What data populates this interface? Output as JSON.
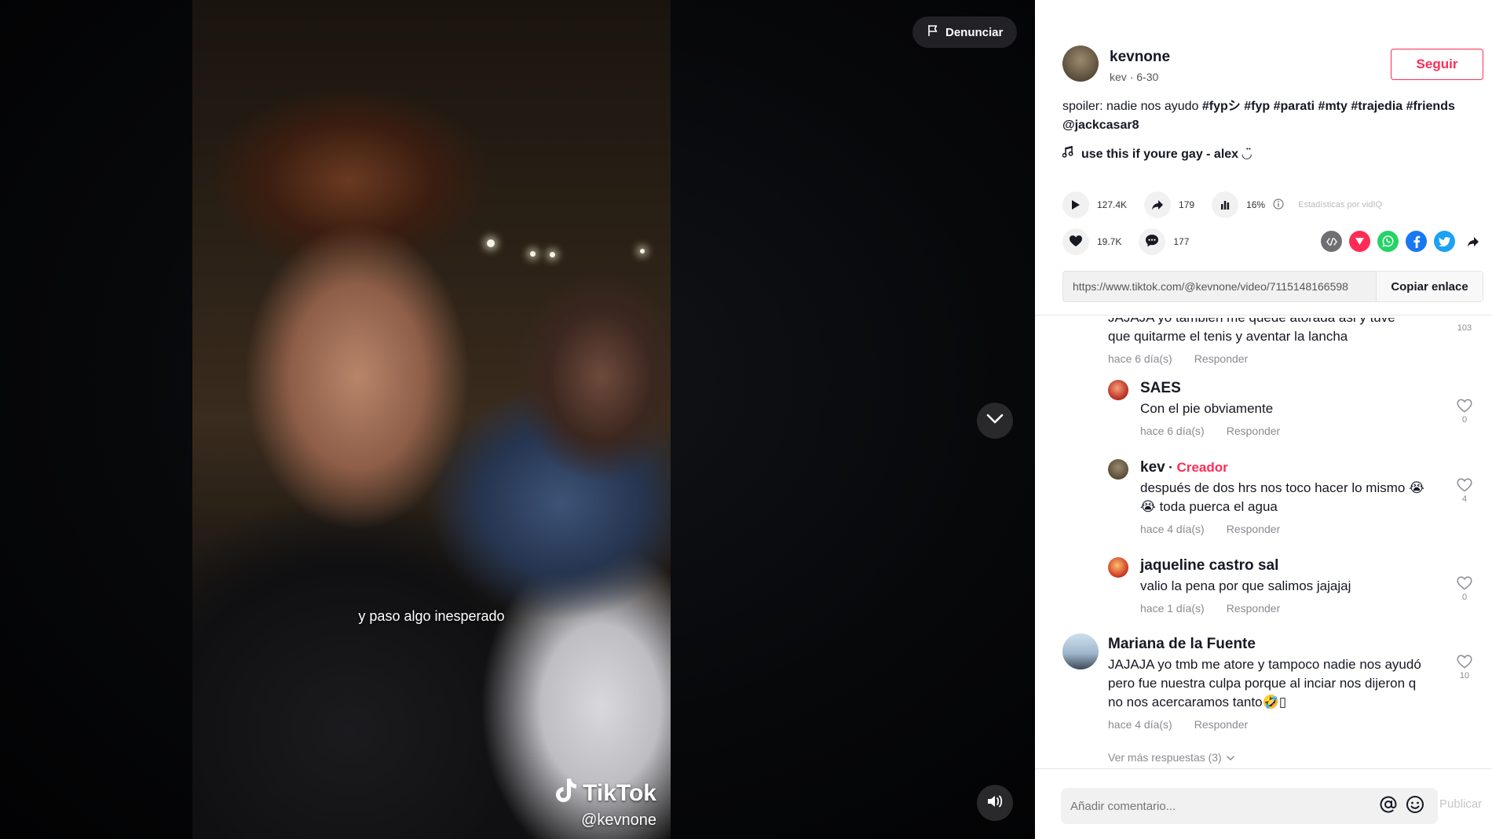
{
  "video": {
    "caption": "y paso algo inesperado",
    "watermark_brand": "TikTok",
    "watermark_handle": "@kevnone",
    "report_label": "Denunciar"
  },
  "author": {
    "username": "kevnone",
    "nickname": "kev",
    "date": "6-30",
    "follow_label": "Seguir"
  },
  "description": {
    "text": "spoiler: nadie nos ayudo ",
    "tags": [
      "#fypシ",
      "#fyp",
      "#parati",
      "#mty",
      "#trajedia",
      "#friends",
      "@jackcasar8"
    ]
  },
  "music": "use this if youre gay - alex ◡̈",
  "stats": {
    "plays": "127.4K",
    "shares": "179",
    "engagement": "16%",
    "vidiq_label": "Estadísticas por vidIQ",
    "likes": "19.7K",
    "comments": "177"
  },
  "share_icons": [
    "embed-icon",
    "pocket-icon",
    "whatsapp-icon",
    "facebook-icon",
    "twitter-icon",
    "share-arrow-icon"
  ],
  "link": {
    "url": "https://www.tiktok.com/@kevnone/video/7115148166598",
    "copy_label": "Copiar enlace"
  },
  "comments": [
    {
      "text_partial": "JAJAJA yo tambien me quede atorada asi y tuve",
      "text": "que quitarme el tenis y aventar la lancha",
      "meta_time": "hace 6 día(s)",
      "meta_reply": "Responder",
      "likes": "103"
    },
    {
      "name": "SAES",
      "text": "Con el pie obviamente",
      "meta_time": "hace 6 día(s)",
      "meta_reply": "Responder",
      "likes": "0"
    },
    {
      "name": "kev",
      "badge": "Creador",
      "text1": "después de dos hrs nos toco hacer lo mismo 😭",
      "text2": "😭 toda puerca el agua",
      "meta_time": "hace 4 día(s)",
      "meta_reply": "Responder",
      "likes": "4"
    },
    {
      "name": "jaqueline castro sal",
      "text": "valio la pena por que salimos jajajaj",
      "meta_time": "hace 1 día(s)",
      "meta_reply": "Responder",
      "likes": "0"
    },
    {
      "name": "Mariana de la Fuente",
      "text1": "JAJAJA yo tmb me atore y tampoco nadie nos ayudó",
      "text2": "pero fue nuestra culpa porque al inciar nos dijeron q",
      "text3": "no nos acercaramos tanto🤣▯",
      "meta_time": "hace 4 día(s)",
      "meta_reply": "Responder",
      "likes": "10"
    }
  ],
  "more_replies": "Ver más respuestas (3)",
  "footer": {
    "placeholder": "Añadir comentario...",
    "post_label": "Publicar"
  },
  "colors": {
    "accent": "#fe2c55",
    "text": "#161823",
    "muted": "#8a8b91"
  }
}
